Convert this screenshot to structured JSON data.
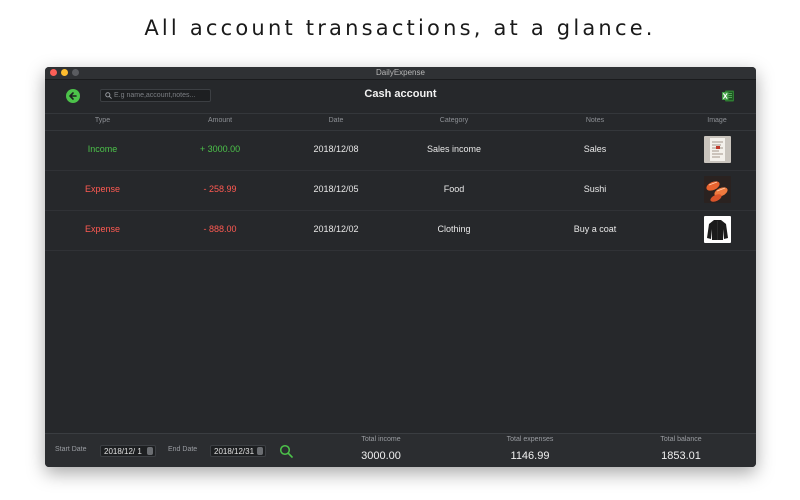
{
  "headline": "All account transactions, at a glance.",
  "window": {
    "title": "DailyExpense"
  },
  "toolbar": {
    "search_placeholder": "E.g name,account,notes...",
    "page_title": "Cash account"
  },
  "table": {
    "headers": {
      "type": "Type",
      "amount": "Amount",
      "date": "Date",
      "category": "Category",
      "notes": "Notes",
      "image": "Image"
    },
    "rows": [
      {
        "type": "Income",
        "amount": "+ 3000.00",
        "date": "2018/12/08",
        "category": "Sales income",
        "notes": "Sales",
        "image": "receipt"
      },
      {
        "type": "Expense",
        "amount": "- 258.99",
        "date": "2018/12/05",
        "category": "Food",
        "notes": "Sushi",
        "image": "sushi"
      },
      {
        "type": "Expense",
        "amount": "- 888.00",
        "date": "2018/12/02",
        "category": "Clothing",
        "notes": "Buy a coat",
        "image": "coat"
      }
    ]
  },
  "footer": {
    "start_label": "Start Date",
    "start_value": "2018/12/ 1",
    "end_label": "End Date",
    "end_value": "2018/12/31",
    "total_income_label": "Total income",
    "total_income": "3000.00",
    "total_expenses_label": "Total expenses",
    "total_expenses": "1146.99",
    "total_balance_label": "Total balance",
    "total_balance": "1853.01"
  },
  "colors": {
    "income": "#4cc24a",
    "expense": "#ff5a52",
    "background": "#26282b"
  }
}
